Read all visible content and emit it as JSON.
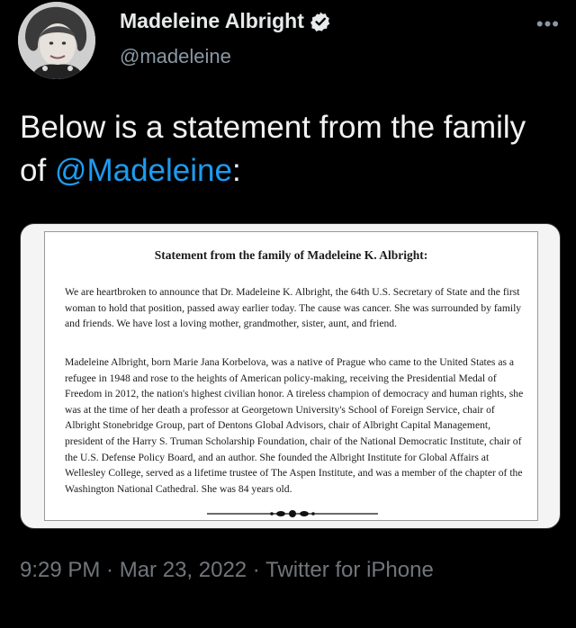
{
  "author": {
    "display_name": "Madeleine Albright",
    "handle": "@madeleine",
    "verified": true
  },
  "more_icon": "•••",
  "tweet": {
    "text_prefix": "Below is a statement from the family of ",
    "mention": "@Madeleine",
    "text_suffix": ":"
  },
  "statement": {
    "title": "Statement from the family of Madeleine K. Albright:",
    "paragraph_1": "We are heartbroken to announce that Dr. Madeleine K. Albright, the 64th U.S. Secretary of State and the first woman to hold that position, passed away earlier today. The cause was cancer. She was surrounded by family and friends. We have lost a loving mother, grandmother, sister, aunt, and friend.",
    "paragraph_2": "Madeleine Albright, born Marie Jana Korbelova, was a native of Prague who came to the United States as a refugee in 1948 and rose to the heights of American policy-making, receiving the Presidential Medal of Freedom in 2012, the nation's highest civilian honor. A tireless champion of democracy and human rights, she was at the time of her death a professor at Georgetown University's School of Foreign Service, chair of Albright Stonebridge Group, part of Dentons Global Advisors, chair of Albright Capital Management, president of the Harry S. Truman Scholarship Foundation, chair of the National Democratic Institute, chair of the U.S. Defense Policy Board, and an author. She founded the Albright Institute for Global Affairs at Wellesley College, served as a lifetime trustee of The Aspen Institute, and was a member of the chapter of the Washington National Cathedral. She was 84 years old."
  },
  "meta": {
    "time": "9:29 PM",
    "separator": " · ",
    "date": "Mar 23, 2022",
    "source": "Twitter for iPhone"
  },
  "colors": {
    "background": "#000000",
    "link": "#1d9bf0",
    "secondary_text": "#71767b",
    "verified_badge": "#e7e9ea"
  }
}
